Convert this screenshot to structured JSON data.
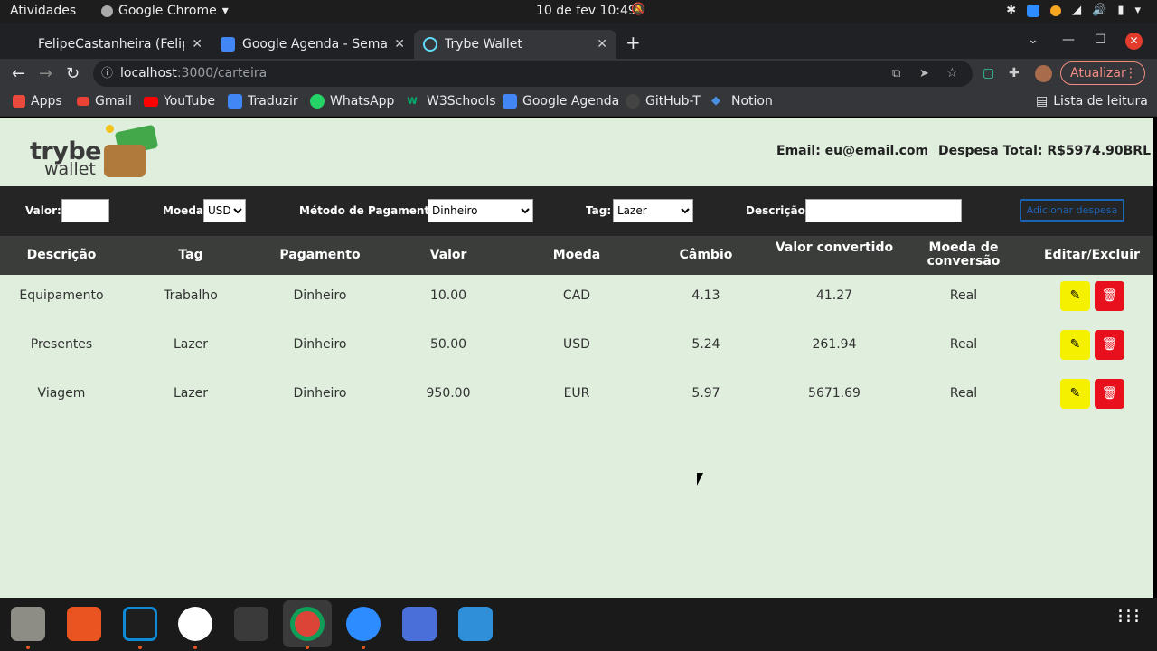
{
  "system": {
    "activities": "Atividades",
    "app_menu": "Google Chrome",
    "clock": "10 de fev  10:49"
  },
  "browser": {
    "tabs": [
      {
        "label": "FelipeCastanheira (Felipe"
      },
      {
        "label": "Google Agenda - Semana"
      },
      {
        "label": "Trybe Wallet"
      }
    ],
    "url_host": "localhost",
    "url_path": ":3000/carteira",
    "update_label": "Atualizar",
    "bookmarks": [
      {
        "label": "Apps",
        "icon": "apps-grid-icon"
      },
      {
        "label": "Gmail",
        "icon": "gmail-icon"
      },
      {
        "label": "YouTube",
        "icon": "youtube-icon"
      },
      {
        "label": "Traduzir",
        "icon": "translate-icon"
      },
      {
        "label": "WhatsApp",
        "icon": "whatsapp-icon"
      },
      {
        "label": "W3Schools",
        "icon": "w3schools-icon"
      },
      {
        "label": "Google Agenda",
        "icon": "calendar-icon"
      },
      {
        "label": "GitHub-T",
        "icon": "github-icon"
      },
      {
        "label": "Notion",
        "icon": "notion-icon"
      }
    ],
    "reading_list": "Lista de leitura"
  },
  "wallet": {
    "logo_line1": "trybe",
    "logo_line2": "wallet",
    "email": "Email: eu@email.com",
    "total": "Despesa Total: R$5974.90BRL",
    "form": {
      "valor_label": "Valor:",
      "valor_value": "",
      "moeda_label": "Moeda",
      "moeda_value": "USD",
      "metodo_label": "Método de Pagamento:",
      "metodo_value": "Dinheiro",
      "tag_label": "Tag:",
      "tag_value": "Lazer",
      "descricao_label": "Descrição:",
      "descricao_value": "",
      "add_button": "Adicionar despesa"
    },
    "table": {
      "headers": [
        "Descrição",
        "Tag",
        "Pagamento",
        "Valor",
        "Moeda",
        "Câmbio",
        "Valor convertido",
        "Moeda de conversão",
        "Editar/Excluir"
      ],
      "rows": [
        [
          "Equipamento",
          "Trabalho",
          "Dinheiro",
          "10.00",
          "CAD",
          "4.13",
          "41.27",
          "Real"
        ],
        [
          "Presentes",
          "Lazer",
          "Dinheiro",
          "50.00",
          "USD",
          "5.24",
          "261.94",
          "Real"
        ],
        [
          "Viagem",
          "Lazer",
          "Dinheiro",
          "950.00",
          "EUR",
          "5.97",
          "5671.69",
          "Real"
        ]
      ]
    }
  },
  "colors": {
    "page_bg": "#dfeedd",
    "form_bg": "#252525",
    "table_header_bg": "#3b3d3b",
    "edit_button": "#f5f000",
    "delete_button": "#e8101c",
    "add_button_border": "#1b63b5"
  }
}
